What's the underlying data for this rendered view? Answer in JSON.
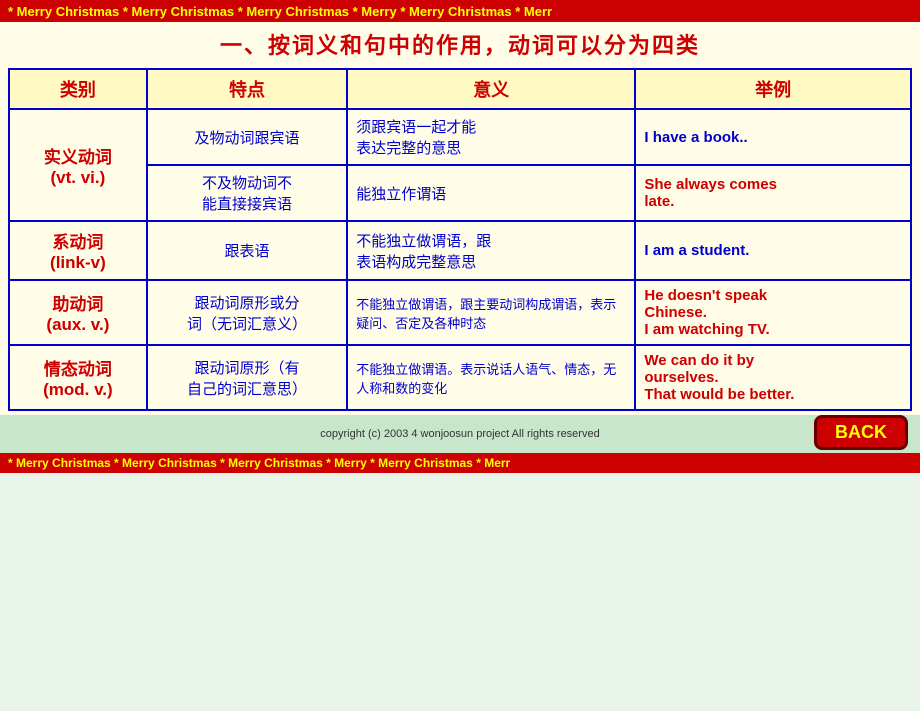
{
  "banner": {
    "text": "* Merry Christmas * Merry Christmas * Merry Christmas * Merry * Merry Christmas * Merr"
  },
  "title": "一、按词义和句中的作用，动词可以分为四类",
  "table": {
    "headers": [
      "类别",
      "特点",
      "意义",
      "举例"
    ],
    "rows": [
      {
        "category": "实义动词\n(vt. vi.)",
        "rowspan": 2,
        "sub_rows": [
          {
            "feature": "及物动词跟宾语",
            "meaning": "须跟宾语一起才能表达完整的意思",
            "example": "I have a book..",
            "example_highlight": false
          },
          {
            "feature": "不及物动词不能直接接宾语",
            "meaning": "能独立作谓语",
            "example": "She always comes late.",
            "example_highlight": true
          }
        ]
      },
      {
        "category": "系动词\n(link-v)",
        "rowspan": 1,
        "sub_rows": [
          {
            "feature": "跟表语",
            "meaning": "不能独立做谓语，跟表语构成完整意思",
            "example": "I am a student.",
            "example_highlight": false
          }
        ]
      },
      {
        "category": "助动词\n(aux. v.)",
        "rowspan": 1,
        "sub_rows": [
          {
            "feature": "跟动词原形或分词（无词汇意义）",
            "meaning": "不能独立做谓语，跟主要动词构成谓语，表示疑问、否定及各种时态",
            "example": "He doesn't speak Chinese.\nI am watching TV.",
            "example_highlight": true
          }
        ]
      },
      {
        "category": "情态动词\n(mod. v.)",
        "rowspan": 1,
        "sub_rows": [
          {
            "feature": "跟动词原形（有自己的词汇意思）",
            "meaning": "不能独立做谓语。表示说话人语气、情态，无人称和数的变化",
            "example": "We can do it by ourselves.\nThat would be better.",
            "example_highlight": true
          }
        ]
      }
    ]
  },
  "copyright": "copyright (c) 2003 4 wonjoosun project All rights reserved",
  "back_button": "BACK"
}
